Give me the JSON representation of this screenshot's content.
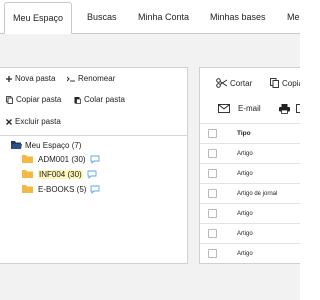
{
  "tabs": [
    {
      "label": "Meu Espaço"
    },
    {
      "label": "Buscas"
    },
    {
      "label": "Minha Conta"
    },
    {
      "label": "Minhas bases"
    },
    {
      "label": "Me"
    }
  ],
  "left_toolbar": {
    "new_folder": "Nova pasta",
    "rename": "Renomear",
    "copy_folder": "Copiar pasta",
    "paste_folder": "Colar pasta",
    "delete_folder": "Excluir pasta"
  },
  "tree": {
    "root_label": "Meu Espaço (7)",
    "folders": [
      {
        "label": "ADM001 (30)",
        "highlighted": false
      },
      {
        "label": "INF004 (30)",
        "highlighted": true
      },
      {
        "label": "E-BOOKS (5)",
        "highlighted": false
      }
    ]
  },
  "right_toolbar": {
    "cut": "Cortar",
    "copy": "Copia",
    "email": "E-mail"
  },
  "grid": {
    "column_type": "Tipo",
    "rows": [
      "Artigo",
      "Artigo",
      "Artigo de jornal",
      "Artigo",
      "Artigo",
      "Artigo"
    ]
  },
  "colors": {
    "folder": "#f4b942",
    "root_folder": "#1f3a66",
    "bubble": "#5aa9e6",
    "highlight": "#fdf6b8"
  }
}
